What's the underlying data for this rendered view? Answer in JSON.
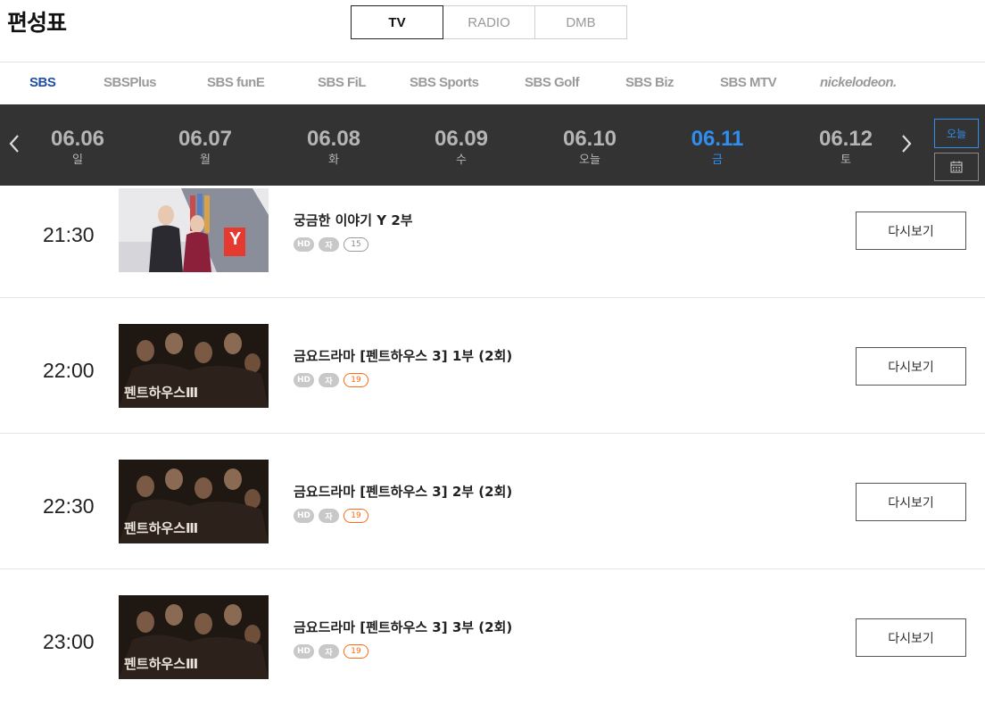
{
  "page": {
    "title": "편성표"
  },
  "media_tabs": [
    {
      "label": "TV",
      "active": true
    },
    {
      "label": "RADIO",
      "active": false
    },
    {
      "label": "DMB",
      "active": false
    }
  ],
  "channels": [
    {
      "label": "SBS",
      "active": true
    },
    {
      "label": "SBSPlus",
      "active": false
    },
    {
      "label": "SBS funE",
      "active": false
    },
    {
      "label": "SBS FiL",
      "active": false
    },
    {
      "label": "SBS Sports",
      "active": false
    },
    {
      "label": "SBS Golf",
      "active": false
    },
    {
      "label": "SBS Biz",
      "active": false
    },
    {
      "label": "SBS MTV",
      "active": false
    },
    {
      "label": "nickelodeon.",
      "active": false
    }
  ],
  "dates": [
    {
      "date": "06.06",
      "day": "일"
    },
    {
      "date": "06.07",
      "day": "월"
    },
    {
      "date": "06.08",
      "day": "화"
    },
    {
      "date": "06.09",
      "day": "수"
    },
    {
      "date": "06.10",
      "day": "오늘"
    },
    {
      "date": "06.11",
      "day": "금",
      "active": true
    },
    {
      "date": "06.12",
      "day": "토"
    }
  ],
  "date_controls": {
    "today_label": "오늘"
  },
  "programs": [
    {
      "time": "21:30",
      "title": "궁금한 이야기 Y 2부",
      "badges": [
        "HD",
        "자"
      ],
      "rating": "15",
      "replay_label": "다시보기",
      "thumb_text": "Y"
    },
    {
      "time": "22:00",
      "title": "금요드라마 [펜트하우스 3] 1부 (2회)",
      "badges": [
        "HD",
        "자"
      ],
      "rating": "19",
      "replay_label": "다시보기",
      "thumb_text": "펜트하우스Ⅲ"
    },
    {
      "time": "22:30",
      "title": "금요드라마 [펜트하우스 3] 2부 (2회)",
      "badges": [
        "HD",
        "자"
      ],
      "rating": "19",
      "replay_label": "다시보기",
      "thumb_text": "펜트하우스Ⅲ"
    },
    {
      "time": "23:00",
      "title": "금요드라마 [펜트하우스 3] 3부 (2회)",
      "badges": [
        "HD",
        "자"
      ],
      "rating": "19",
      "replay_label": "다시보기",
      "thumb_text": "펜트하우스Ⅲ"
    }
  ],
  "icons": {
    "prev": "chevron-left-icon",
    "next": "chevron-right-icon",
    "calendar": "calendar-icon"
  },
  "colors": {
    "accent_blue": "#2f8ef0",
    "channel_active": "#1d4fa8",
    "rating_19": "#ff6a16",
    "date_bar_bg": "#333333"
  }
}
